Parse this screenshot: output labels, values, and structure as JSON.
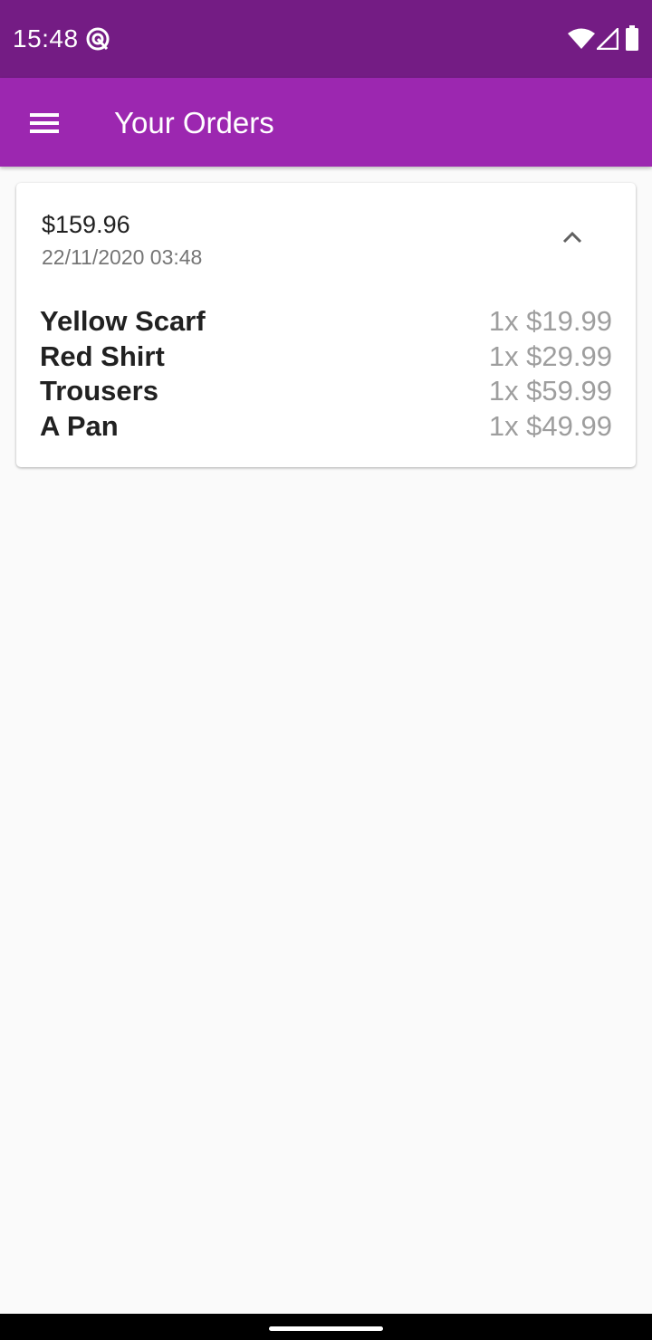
{
  "status_bar": {
    "time": "15:48",
    "icons": [
      "notification-icon",
      "wifi-icon",
      "signal-icon",
      "battery-icon"
    ],
    "background": "#741c84"
  },
  "app_bar": {
    "title": "Your Orders",
    "menu_icon": "hamburger-menu-icon",
    "background": "#9c27b0"
  },
  "order": {
    "amount": "$159.96",
    "date": "22/11/2020 03:48",
    "expand_icon": "chevron-up-icon",
    "items": [
      {
        "name": "Yellow Scarf",
        "qty_price": "1x $19.99"
      },
      {
        "name": "Red Shirt",
        "qty_price": "1x $29.99"
      },
      {
        "name": "Trousers",
        "qty_price": "1x $59.99"
      },
      {
        "name": "A Pan",
        "qty_price": "1x $49.99"
      }
    ]
  }
}
